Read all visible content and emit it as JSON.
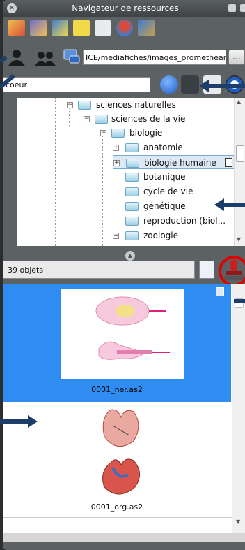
{
  "window": {
    "title": "Navigateur de ressources"
  },
  "toolbar": {
    "tools": [
      {
        "icon": "resources-icon",
        "color": "#d94b3a"
      },
      {
        "icon": "clapperboard-icon",
        "color": "#6c6cd1"
      },
      {
        "icon": "picture-icon",
        "color": "#3a7bd5"
      },
      {
        "icon": "sticky-note-icon",
        "color": "#f2d94a"
      },
      {
        "icon": "notes-icon",
        "color": "#9aa0a6"
      },
      {
        "icon": "pin-icon",
        "color": "#d94b3a"
      },
      {
        "icon": "tools-icon",
        "color": "#3a7bd5"
      }
    ]
  },
  "path": {
    "value": "ICE/mediafiches/images_promethean",
    "browse_label": "..."
  },
  "search": {
    "value": "coeur"
  },
  "tree": {
    "items": [
      {
        "label": "sciences naturelles",
        "level": 0,
        "expander": "minus"
      },
      {
        "label": "sciences de la vie",
        "level": 1,
        "expander": "minus"
      },
      {
        "label": "biologie",
        "level": 2,
        "expander": "minus"
      },
      {
        "label": "anatomie",
        "level": 3,
        "expander": "plus"
      },
      {
        "label": "biologie humaine",
        "level": 3,
        "expander": "plus",
        "selected": true
      },
      {
        "label": "botanique",
        "level": 3,
        "expander": "none"
      },
      {
        "label": "cycle de vie",
        "level": 3,
        "expander": "none"
      },
      {
        "label": "génétique",
        "level": 3,
        "expander": "none"
      },
      {
        "label": "reproduction (biol...",
        "level": 3,
        "expander": "none"
      },
      {
        "label": "zoologie",
        "level": 3,
        "expander": "plus"
      }
    ]
  },
  "results": {
    "count_label": "39 objets",
    "items": [
      {
        "label": "0001_ner.as2",
        "selected": true
      },
      {
        "label": "0001_org.as2",
        "selected": false
      }
    ]
  },
  "colors": {
    "selection": "#2f8cf0",
    "annotation_arrow": "#1d3d6b",
    "highlight_circle": "#e00000"
  }
}
